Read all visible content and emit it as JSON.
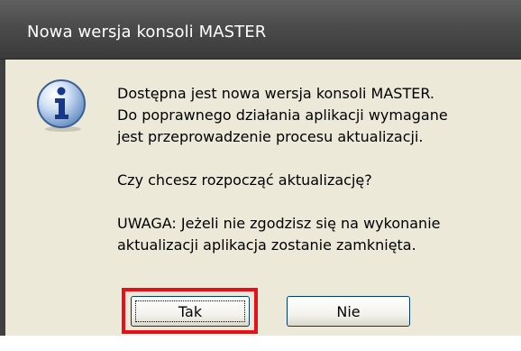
{
  "dialog": {
    "title": "Nowa wersja konsoli MASTER",
    "message_lines": [
      "Dostępna jest nowa wersja konsoli MASTER.\nDo poprawnego działania aplikacji wymagane\njest przeprowadzenie procesu aktualizacji.",
      "Czy chcesz rozpocząć aktualizację?",
      "UWAGA: Jeżeli nie zgodzisz się na wykonanie\naktualizacji aplikacja zostanie zamknięta."
    ],
    "icon": "information-icon",
    "buttons": {
      "yes_label": "Tak",
      "no_label": "Nie"
    }
  },
  "colors": {
    "titlebar": "#4b4b4b",
    "dialog_background": "#ece9d8",
    "highlight_border": "#e5101a",
    "button_border": "#003c74"
  }
}
